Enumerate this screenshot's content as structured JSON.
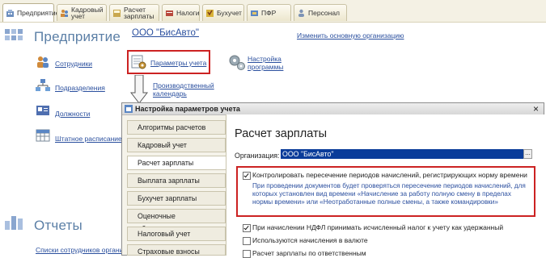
{
  "tabs": [
    {
      "label": "Предприятие",
      "icon": "building-icon",
      "active": true
    },
    {
      "label": "Кадровый учет",
      "icon": "people-icon",
      "active": false
    },
    {
      "label": "Расчет зарплаты",
      "icon": "calculator-icon",
      "active": false
    },
    {
      "label": "Налоги",
      "icon": "tax-icon",
      "active": false
    },
    {
      "label": "Бухучет",
      "icon": "ledger-icon",
      "active": false
    },
    {
      "label": "ПФР",
      "icon": "pension-icon",
      "active": false
    },
    {
      "label": "Персонал",
      "icon": "person-icon",
      "active": false
    }
  ],
  "main": {
    "section_title": "Предприятие",
    "org_name": "ООО \"БисАвто\"",
    "change_org_link": "Изменить основную организацию",
    "side_links": [
      "Сотрудники",
      "Подразделения",
      "Должности",
      "Штатное расписание"
    ],
    "params_link": "Параметры учета",
    "program_settings_link": "Настройка программы",
    "calendar_link": "Производственный календарь",
    "reports_title": "Отчеты",
    "reports_link": "Списки сотрудников органи"
  },
  "dialog": {
    "title": "Настройка параметров учета",
    "close_glyph": "×",
    "nav_items": [
      "Алгоритмы расчетов",
      "Кадровый учет",
      "Расчет зарплаты",
      "Выплата зарплаты",
      "Бухучет зарплаты",
      "Оценочные обязательства",
      "Налоговый учет",
      "Страховые взносы"
    ],
    "active_nav_index": 2,
    "content_title": "Расчет зарплаты",
    "org_label": "Организация:",
    "org_value": "ООО \"БисАвто\"",
    "org_button": "...",
    "check_overlap_label": "Контролировать пересечение периодов начислений, регистрирующих норму времени",
    "check_overlap_hint": "При проведении документов будет проверяться пересечение периодов начислений, для которых установлен вид времени «Начисление за работу полную смену в пределах нормы времени» или «Неотработанные полные смены, а также командировки»",
    "ndfl_label": "При начислении НДФЛ принимать исчисленный налог к учету как удержанный",
    "currency_label": "Используются начисления в валюте",
    "responsible_label": "Расчет зарплаты по ответственным",
    "checks": {
      "overlap": true,
      "ndfl": true,
      "currency": false,
      "responsible": false
    }
  },
  "colors": {
    "highlight_red": "#cc2222",
    "link_blue": "#2a4f9e",
    "title_blue": "#5b7fa6",
    "hint_blue": "#2b4f9f",
    "selected_field": "#0a3c9a"
  }
}
